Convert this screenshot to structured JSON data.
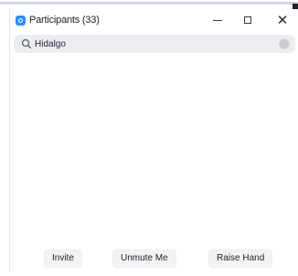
{
  "window": {
    "title": "Participants (33)"
  },
  "title_controls": {
    "minimize_icon": "minimize-icon",
    "maximize_icon": "maximize-icon",
    "close_icon": "close-icon",
    "close_glyph": "✕"
  },
  "search": {
    "value": "Hidalgo",
    "placeholder": "",
    "icon": "search-icon",
    "clear_icon": "clear-search-icon"
  },
  "participants": [],
  "footer": {
    "invite_label": "Invite",
    "unmute_label": "Unmute Me",
    "raise_hand_label": "Raise Hand"
  },
  "colors": {
    "app_icon": "#2d8cff",
    "search_bg": "#ecedf1",
    "text": "#232333"
  }
}
